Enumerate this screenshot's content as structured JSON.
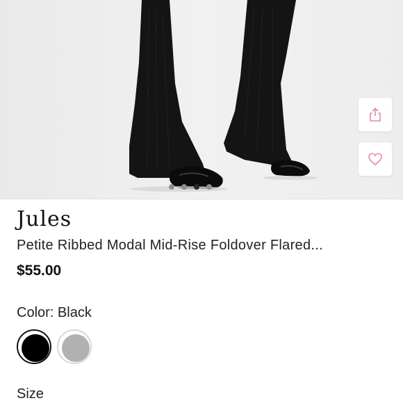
{
  "gallery": {
    "image_alt": "Black ribbed flared pants worn with black ballet flats",
    "dot_count": 4,
    "active_dot": 2
  },
  "actions": {
    "share_icon": "share-icon",
    "favorite_icon": "heart-icon"
  },
  "product": {
    "brand": "Jules",
    "name": "Petite Ribbed Modal Mid-Rise Foldover Flared...",
    "price": "$55.00"
  },
  "color": {
    "label": "Color:",
    "selected": "Black",
    "swatches": [
      {
        "name": "Black",
        "hex": "#000000"
      },
      {
        "name": "Grey",
        "hex": "#b1b1b1"
      }
    ]
  },
  "size": {
    "label": "Size"
  },
  "colors": {
    "accent_pink": "#e58aa5"
  }
}
